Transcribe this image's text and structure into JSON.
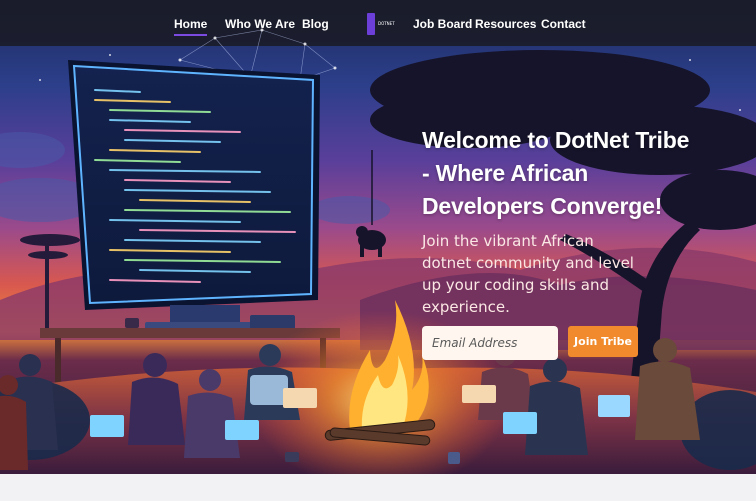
{
  "nav": {
    "items": [
      {
        "label": "Home",
        "active": true
      },
      {
        "label": "Who We Are"
      },
      {
        "label": "Blog"
      },
      {
        "label": "Job Board"
      },
      {
        "label": "Resources"
      },
      {
        "label": "Contact"
      }
    ],
    "logo_text": "DOTNET",
    "active_color": "#7b4ae0"
  },
  "hero": {
    "title": "Welcome to DotNet Tribe - Where African Developers Converge!",
    "subtitle": "Join the vibrant African dotnet community and level up your coding skills and experience.",
    "email_placeholder": "Email Address",
    "cta_label": "Join Tribe",
    "cta_color": "#f08a2c",
    "illustration": "developers-campfire-illustration"
  }
}
